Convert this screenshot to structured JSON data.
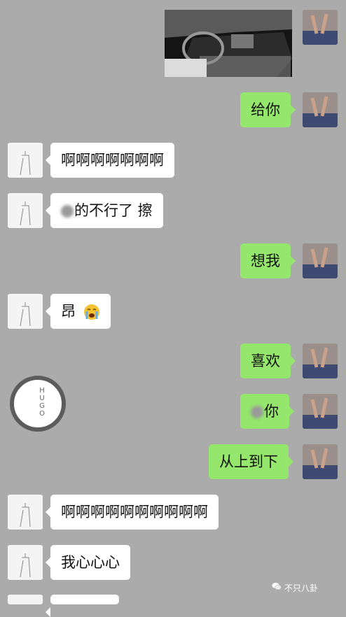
{
  "messages": [
    {
      "side": "out",
      "type": "image",
      "content": "photo"
    },
    {
      "side": "out",
      "text": "给你"
    },
    {
      "side": "in",
      "text": "啊啊啊啊啊啊啊"
    },
    {
      "side": "in",
      "text_after_blur": "的不行了 擦"
    },
    {
      "side": "out",
      "text": "想我"
    },
    {
      "side": "in",
      "text": "昂",
      "emoji": "crying-face-icon"
    },
    {
      "side": "out",
      "text": "喜欢"
    },
    {
      "side": "out",
      "text_after_blur": "你"
    },
    {
      "side": "out",
      "text": "从上到下"
    },
    {
      "side": "in",
      "text": "啊啊啊啊啊啊啊啊啊啊"
    },
    {
      "side": "in",
      "text": "我心心心"
    }
  ],
  "sticker": {
    "brand": "HUGO"
  },
  "watermark": {
    "text": "不只八卦"
  },
  "colors": {
    "background": "#ababab",
    "outgoing_bubble": "#95e66c",
    "incoming_bubble": "#ffffff"
  }
}
